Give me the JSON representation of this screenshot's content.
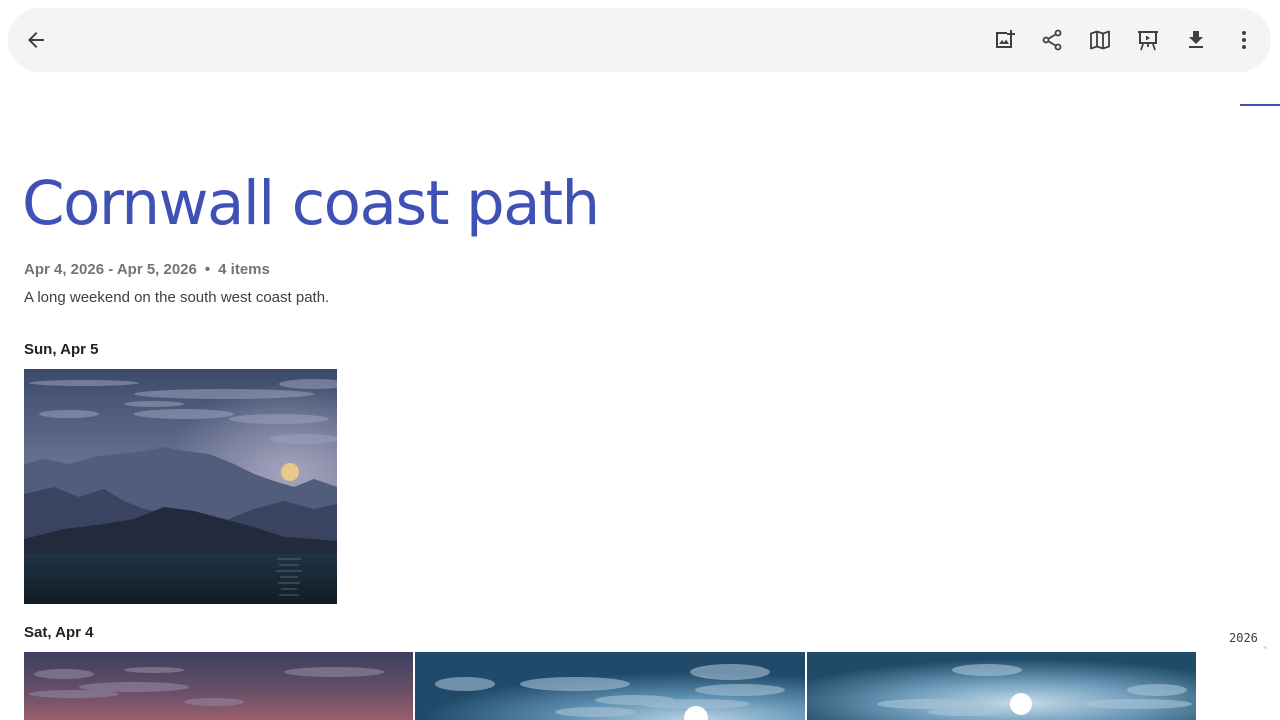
{
  "toolbar": {
    "icons": [
      "back-arrow-icon",
      "add-photos-icon",
      "share-icon",
      "map-icon",
      "slideshow-icon",
      "download-icon",
      "more-vert-icon"
    ]
  },
  "album": {
    "title": "Cornwall coast path",
    "date_range": "Apr 4, 2026 - Apr 5, 2026",
    "separator": "•",
    "item_count": "4 items",
    "description": "A long weekend on the south west coast path."
  },
  "groups": [
    {
      "date": "Sun, Apr 5",
      "photos": 1
    },
    {
      "date": "Sat, Apr 4",
      "photos": 3
    }
  ],
  "timeline": {
    "year": "2026"
  },
  "colors": {
    "accent": "#3f51b5",
    "toolbar_bg": "#f4f4f4"
  }
}
